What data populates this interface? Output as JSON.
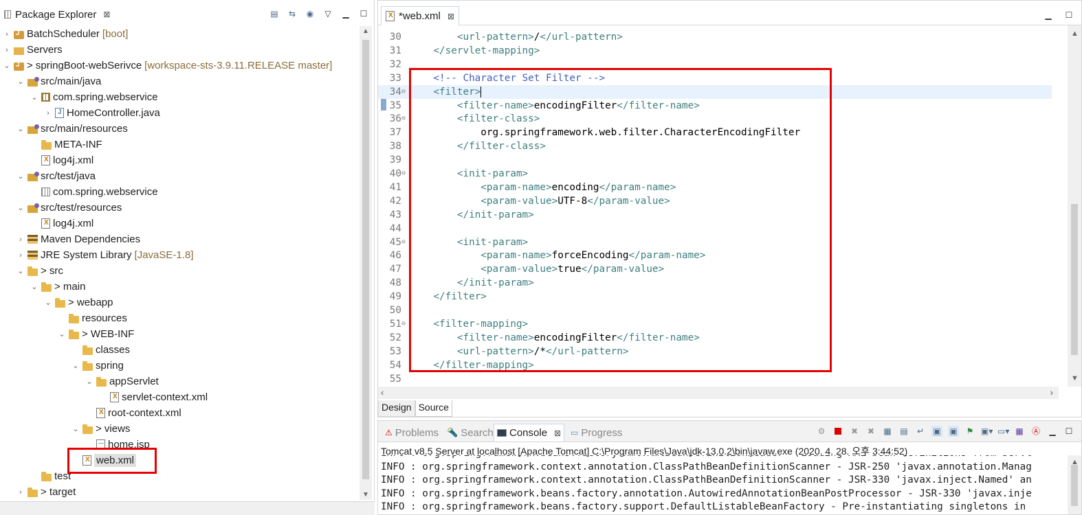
{
  "explorer": {
    "title": "Package Explorer",
    "close": "⊠",
    "items": [
      {
        "label": "BatchScheduler",
        "deco": "[boot]"
      },
      {
        "label": "Servers",
        "deco": ""
      },
      {
        "label": "> springBoot-webSerivce",
        "deco": "[workspace-sts-3.9.11.RELEASE master]"
      },
      {
        "label": "src/main/java",
        "deco": ""
      },
      {
        "label": "com.spring.webservice",
        "deco": ""
      },
      {
        "label": "HomeController.java",
        "deco": ""
      },
      {
        "label": "src/main/resources",
        "deco": ""
      },
      {
        "label": "META-INF",
        "deco": ""
      },
      {
        "label": "log4j.xml",
        "deco": ""
      },
      {
        "label": "src/test/java",
        "deco": ""
      },
      {
        "label": "com.spring.webservice",
        "deco": ""
      },
      {
        "label": "src/test/resources",
        "deco": ""
      },
      {
        "label": "log4j.xml",
        "deco": ""
      },
      {
        "label": "Maven Dependencies",
        "deco": ""
      },
      {
        "label": "JRE System Library",
        "deco": "[JavaSE-1.8]"
      },
      {
        "label": "> src",
        "deco": ""
      },
      {
        "label": "> main",
        "deco": ""
      },
      {
        "label": "> webapp",
        "deco": ""
      },
      {
        "label": "resources",
        "deco": ""
      },
      {
        "label": "> WEB-INF",
        "deco": ""
      },
      {
        "label": "classes",
        "deco": ""
      },
      {
        "label": "spring",
        "deco": ""
      },
      {
        "label": "appServlet",
        "deco": ""
      },
      {
        "label": "servlet-context.xml",
        "deco": ""
      },
      {
        "label": "root-context.xml",
        "deco": ""
      },
      {
        "label": "> views",
        "deco": ""
      },
      {
        "label": "home.jsp",
        "deco": ""
      },
      {
        "label": "web.xml",
        "deco": ""
      },
      {
        "label": "test",
        "deco": ""
      },
      {
        "label": "> target",
        "deco": ""
      }
    ]
  },
  "editor": {
    "tab_label": "*web.xml",
    "tab_close": "⊠",
    "mode_tabs": [
      "Design",
      "Source"
    ],
    "lines": [
      {
        "num": "30",
        "text": "        <url-pattern>/</url-pattern>"
      },
      {
        "num": "31",
        "text": "    </servlet-mapping>"
      },
      {
        "num": "32",
        "text": ""
      },
      {
        "num": "33",
        "text": "    <!-- Character Set Filter -->"
      },
      {
        "num": "34",
        "text": "    <filter>"
      },
      {
        "num": "35",
        "text": "        <filter-name>encodingFilter</filter-name>"
      },
      {
        "num": "36",
        "text": "        <filter-class>"
      },
      {
        "num": "37",
        "text": "            org.springframework.web.filter.CharacterEncodingFilter"
      },
      {
        "num": "38",
        "text": "        </filter-class>"
      },
      {
        "num": "39",
        "text": ""
      },
      {
        "num": "40",
        "text": "        <init-param>"
      },
      {
        "num": "41",
        "text": "            <param-name>encoding</param-name>"
      },
      {
        "num": "42",
        "text": "            <param-value>UTF-8</param-value>"
      },
      {
        "num": "43",
        "text": "        </init-param>"
      },
      {
        "num": "44",
        "text": ""
      },
      {
        "num": "45",
        "text": "        <init-param>"
      },
      {
        "num": "46",
        "text": "            <param-name>forceEncoding</param-name>"
      },
      {
        "num": "47",
        "text": "            <param-value>true</param-value>"
      },
      {
        "num": "48",
        "text": "        </init-param>"
      },
      {
        "num": "49",
        "text": "    </filter>"
      },
      {
        "num": "50",
        "text": ""
      },
      {
        "num": "51",
        "text": "    <filter-mapping>"
      },
      {
        "num": "52",
        "text": "        <filter-name>encodingFilter</filter-name>"
      },
      {
        "num": "53",
        "text": "        <url-pattern>/*</url-pattern>"
      },
      {
        "num": "54",
        "text": "    </filter-mapping>"
      },
      {
        "num": "55",
        "text": ""
      }
    ],
    "fold_lines": [
      "34",
      "36",
      "40",
      "45",
      "51"
    ],
    "current_line": "34"
  },
  "console": {
    "tabs": [
      "Problems",
      "Search",
      "Console",
      "Progress"
    ],
    "active_tab": "Console",
    "tab_close": "⊠",
    "title": "Tomcat v8.5 Server at localhost [Apache Tomcat] C:\\Program Files\\Java\\jdk-13.0.2\\bin\\javaw.exe (2020. 4. 28. 오후 3:44:52)",
    "lines": [
      "INFO : org.springframework.beans.factory.xml.XmlBeanDefinitionReader - Loading XML bean definitions from servl",
      "INFO : org.springframework.context.annotation.ClassPathBeanDefinitionScanner - JSR-250 'javax.annotation.Manag",
      "INFO : org.springframework.context.annotation.ClassPathBeanDefinitionScanner - JSR-330 'javax.inject.Named' an",
      "INFO : org.springframework.beans.factory.annotation.AutowiredAnnotationBeanPostProcessor - JSR-330 'javax.inje",
      "INFO : org.springframework.beans.factory.support.DefaultListableBeanFactory - Pre-instantiating singletons in"
    ]
  },
  "colors": {
    "highlight": "#e60000",
    "xml_tag": "#3f7f7f",
    "xml_comment": "#3f5fbf",
    "current_line": "#e8f2fe"
  }
}
